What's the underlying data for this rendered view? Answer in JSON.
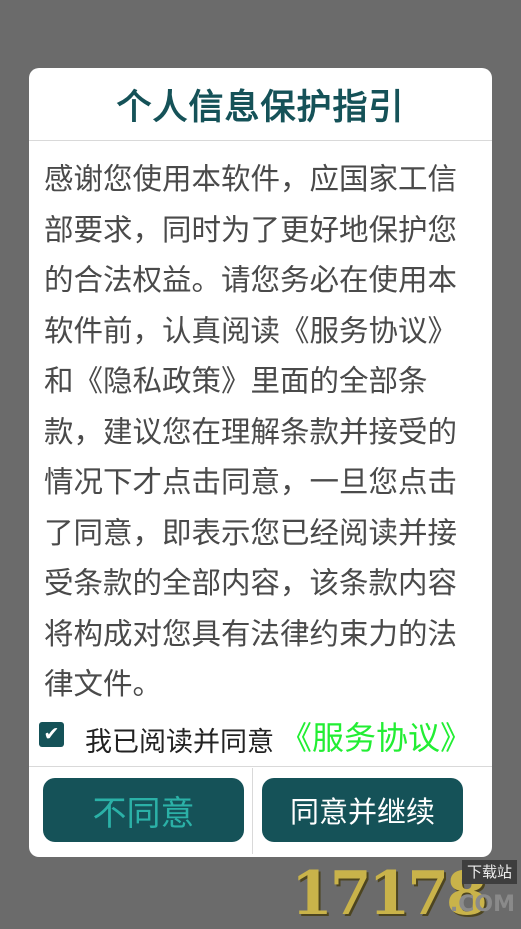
{
  "dialog": {
    "title": "个人信息保护指引",
    "body": "感谢您使用本软件，应国家工信部要求，同时为了更好地保护您的合法权益。请您务必在使用本软件前，认真阅读《服务协议》和《隐私政策》里面的全部条款，建议您在理解条款并接受的情况下才点击同意，一旦您点击了同意，即表示您已经阅读并接受条款的全部内容，该条款内容将构成对您具有法律约束力的法律文件。",
    "agree_checked": true,
    "agree_label": "我已阅读并同意",
    "agree_link": "《服务协议》",
    "disagree_button": "不同意",
    "agree_button": "同意并继续"
  },
  "watermark": {
    "number": "17178",
    "domain": ".COM",
    "badge": "下载站"
  },
  "colors": {
    "overlay": "#6b6b6b",
    "accent": "#155258",
    "link": "#22ee33",
    "disagree_text": "#2bb1a7"
  }
}
